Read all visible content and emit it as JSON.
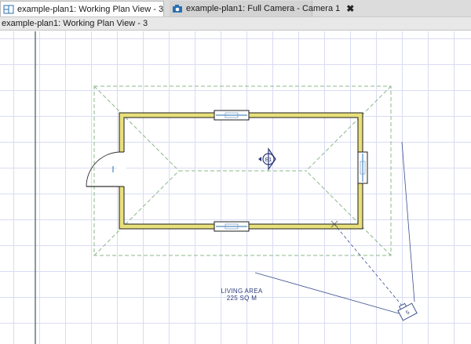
{
  "tabs": [
    {
      "label": "example-plan1:  Working Plan View - 3",
      "close": "✖",
      "icon": "plan-view-icon",
      "active": true
    },
    {
      "label": "example-plan1: Full Camera - Camera 1",
      "close": "✖",
      "icon": "camera-icon",
      "active": false
    }
  ],
  "view_title": "example-plan1:  Working Plan View - 3",
  "plan": {
    "elevation_marker": "E1",
    "camera_label": "5",
    "room": {
      "name": "LIVING AREA",
      "area": "225 SQ M"
    }
  },
  "colors": {
    "wall_fill": "#e8e07a",
    "wall_line": "#1d1d1d",
    "roof_line": "#8db88a",
    "grid_line": "#d9dcf3",
    "room_label": "#2c3a78",
    "camera_line": "#3a4e8c"
  }
}
